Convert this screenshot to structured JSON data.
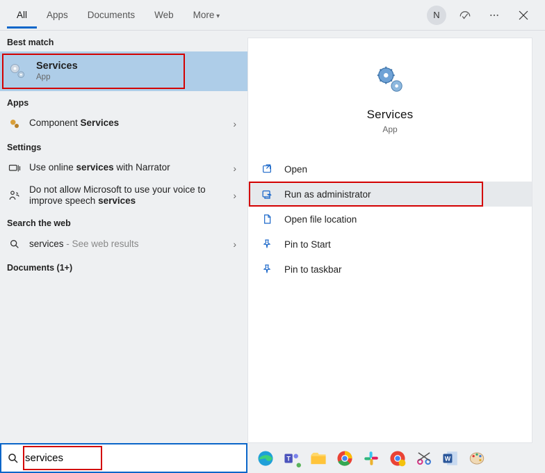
{
  "tabs": {
    "items": [
      "All",
      "Apps",
      "Documents",
      "Web",
      "More"
    ],
    "active_index": 0
  },
  "titlebar": {
    "avatar_letter": "N"
  },
  "left": {
    "best_match_h": "Best match",
    "best": {
      "title": "Services",
      "subtitle": "App"
    },
    "apps_h": "Apps",
    "apps": [
      {
        "prefix": "Component ",
        "bold": "Services"
      }
    ],
    "settings_h": "Settings",
    "settings": [
      {
        "pre": "Use online ",
        "bold": "services",
        "post": " with Narrator"
      },
      {
        "pre": "Do not allow Microsoft to use your voice to improve speech ",
        "bold": "services",
        "post": ""
      }
    ],
    "web_h": "Search the web",
    "web": {
      "term": "services",
      "suffix": " - See web results"
    },
    "docs_h": "Documents (1+)"
  },
  "right": {
    "title": "Services",
    "subtitle": "App",
    "actions": [
      {
        "id": "open",
        "label": "Open",
        "selected": false
      },
      {
        "id": "run-admin",
        "label": "Run as administrator",
        "selected": true
      },
      {
        "id": "open-loc",
        "label": "Open file location",
        "selected": false
      },
      {
        "id": "pin-start",
        "label": "Pin to Start",
        "selected": false
      },
      {
        "id": "pin-taskbar",
        "label": "Pin to taskbar",
        "selected": false
      }
    ]
  },
  "search": {
    "value": "services"
  },
  "taskbar_icons": [
    "edge",
    "teams",
    "explorer",
    "chrome",
    "slack",
    "chrome-profile",
    "snip",
    "word",
    "paint"
  ]
}
